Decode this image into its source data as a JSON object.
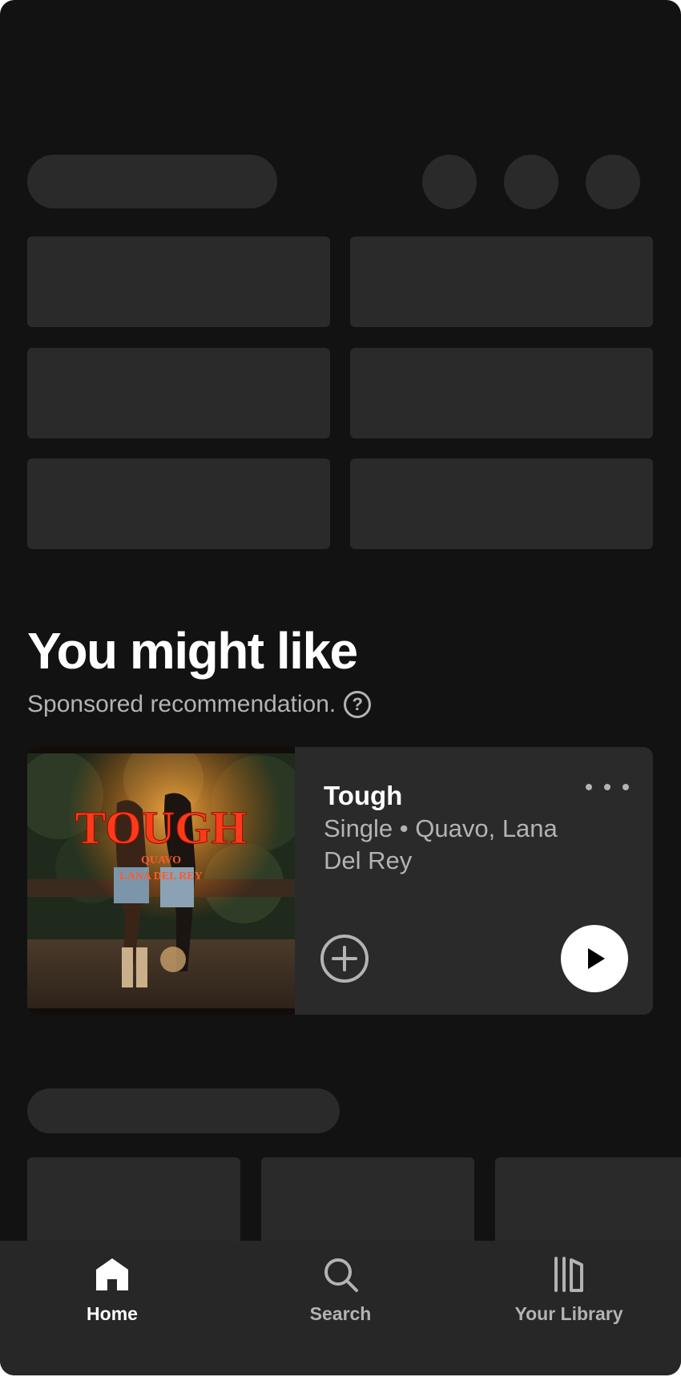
{
  "section": {
    "title": "You might like",
    "subtitle": "Sponsored recommendation.",
    "help_symbol": "?"
  },
  "recommendation": {
    "cover_lettering": {
      "title": "TOUGH",
      "artist1": "QUAVO",
      "artist2": "LANA DEL REY"
    },
    "title": "Tough",
    "subtitle": "Single • Quavo, Lana Del Rey",
    "icons": {
      "more": "more-horizontal-icon",
      "add": "plus-circle-icon",
      "play": "play-icon"
    }
  },
  "nav": {
    "items": [
      {
        "label": "Home",
        "icon": "home-icon",
        "active": true
      },
      {
        "label": "Search",
        "icon": "search-icon",
        "active": false
      },
      {
        "label": "Your Library",
        "icon": "library-icon",
        "active": false
      }
    ]
  },
  "colors": {
    "background": "#121212",
    "skeleton": "#2a2a2a",
    "card": "#2a2a2a",
    "nav_background": "#272727",
    "text_primary": "#ffffff",
    "text_secondary": "#b3b3b3"
  }
}
